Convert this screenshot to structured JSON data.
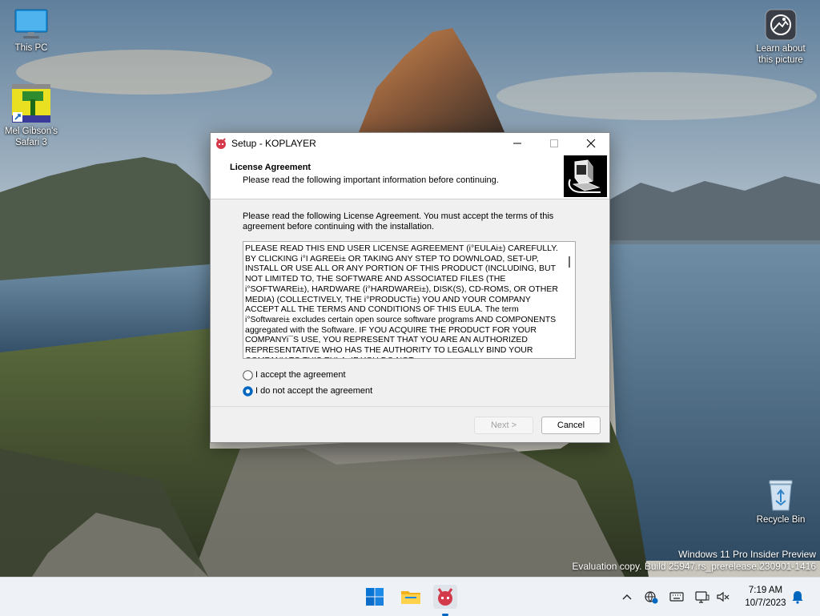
{
  "desktop": {
    "icons": [
      {
        "label": "This PC"
      },
      {
        "label": "Mel Gibson's Safari 3"
      },
      {
        "label": "Learn about this picture"
      },
      {
        "label": "Recycle Bin"
      }
    ],
    "watermark": {
      "line1": "Windows 11 Pro Insider Preview",
      "line2": "Evaluation copy. Build 25947.rs_prerelease.230901-1416"
    }
  },
  "window": {
    "title": "Setup - KOPLAYER",
    "header": {
      "title": "License Agreement",
      "subtitle": "Please read the following important information before continuing."
    },
    "intro": "Please read the following License Agreement. You must accept the terms of this agreement before continuing with the installation.",
    "license_text": "PLEASE READ THIS END USER LICENSE AGREEMENT (i°EULAi±) CAREFULLY.  BY CLICKING i°I AGREEi± OR TAKING ANY STEP TO DOWNLOAD, SET-UP, INSTALL OR USE ALL OR ANY PORTION OF THIS PRODUCT (INCLUDING, BUT NOT LIMITED TO, THE SOFTWARE AND ASSOCIATED FILES (THE i°SOFTWAREi±), HARDWARE (i°HARDWAREi±), DISK(S), CD-ROMS, OR OTHER MEDIA) (COLLECTIVELY, THE i°PRODUCTi±) YOU AND YOUR COMPANY ACCEPT ALL THE TERMS AND CONDITIONS OF THIS EULA.  The term i°Softwarei± excludes certain open source software programs AND COMPONENTS aggregated with the Software.  IF YOU ACQUIRE THE PRODUCT FOR YOUR COMPANYi¯S USE, YOU REPRESENT THAT YOU ARE AN AUTHORIZED REPRESENTATIVE WHO HAS THE AUTHORITY TO LEGALLY BIND YOUR COMPANY TO THIS EULA.  IF YOU DO NOT",
    "options": {
      "accept": "I accept the agreement",
      "decline": "I do not accept the agreement",
      "selected": "decline"
    },
    "buttons": {
      "next": "Next >",
      "cancel": "Cancel"
    }
  },
  "taskbar": {
    "clock_time": "7:19 AM",
    "clock_date": "10/7/2023"
  },
  "colors": {
    "accent": "#0067c0",
    "koplayer_red": "#d33a4a"
  }
}
